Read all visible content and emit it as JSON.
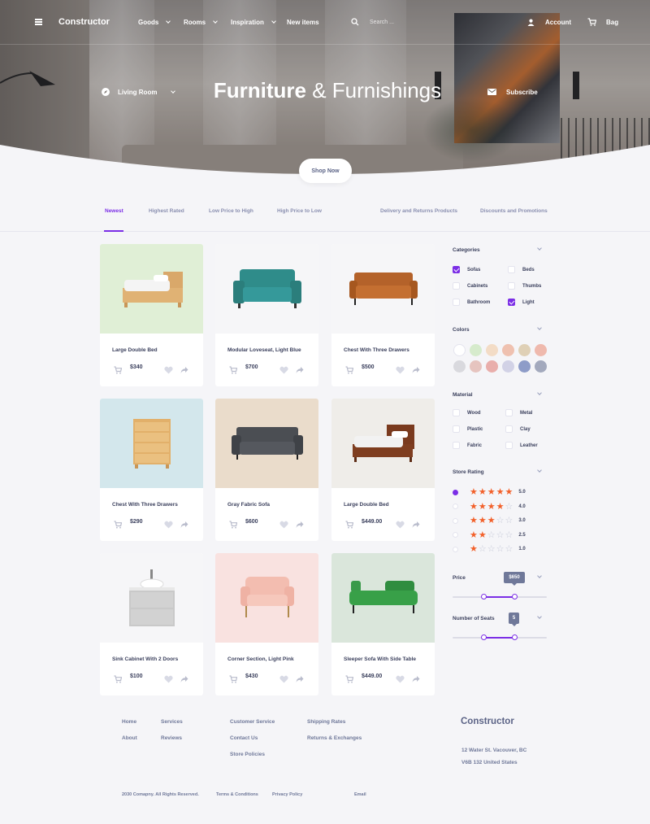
{
  "header": {
    "brand": "Constructor",
    "nav": [
      {
        "label": "Goods"
      },
      {
        "label": "Rooms"
      },
      {
        "label": "Inspiration"
      },
      {
        "label": "New items"
      }
    ],
    "search_placeholder": "Search ...",
    "account_label": "Account",
    "bag_label": "Bag"
  },
  "hero": {
    "room_select": "Living Room",
    "title_bold": "Furniture",
    "title_rest": "& Furnishings",
    "subscribe_label": "Subscribe",
    "shop_button": "Shop Now"
  },
  "tabs": [
    {
      "label": "Newest",
      "active": true
    },
    {
      "label": "Highest Rated"
    },
    {
      "label": "Low Price to High"
    },
    {
      "label": "High Price to Low"
    },
    {
      "label": "Delivery and Returns Products"
    },
    {
      "label": "Discounts and Promotions"
    }
  ],
  "products": [
    {
      "name": "Large Double Bed",
      "price": "$340",
      "bg": "#e0efd6",
      "icon": "bed"
    },
    {
      "name": "Modular Loveseat, Light Blue",
      "price": "$700",
      "bg": "#f6f6f8",
      "icon": "teal-loveseat"
    },
    {
      "name": "Chest With Three Drawers",
      "price": "$500",
      "bg": "#f6f6f8",
      "icon": "brown-sofa"
    },
    {
      "name": "Chest With Three Drawers",
      "price": "$290",
      "bg": "#d3e7ec",
      "icon": "wood-chest"
    },
    {
      "name": "Gray Fabric Sofa",
      "price": "$600",
      "bg": "#eadccb",
      "icon": "gray-sofa"
    },
    {
      "name": "Large Double Bed",
      "price": "$449.00",
      "bg": "#efede9",
      "icon": "dark-bed"
    },
    {
      "name": "Sink Cabinet With 2 Doors",
      "price": "$100",
      "bg": "#f6f6f8",
      "icon": "sink-cabinet"
    },
    {
      "name": "Corner Section, Light Pink",
      "price": "$430",
      "bg": "#f9e2e0",
      "icon": "pink-chair"
    },
    {
      "name": "Sleeper Sofa With Side Table",
      "price": "$449.00",
      "bg": "#dae6db",
      "icon": "green-sofa"
    }
  ],
  "filters": {
    "categories": {
      "title": "Categories",
      "items": [
        {
          "label": "Sofas",
          "checked": true
        },
        {
          "label": "Beds",
          "checked": false
        },
        {
          "label": "Cabinets",
          "checked": false
        },
        {
          "label": "Thumbs",
          "checked": false
        },
        {
          "label": "Bathroom",
          "checked": false
        },
        {
          "label": "Light",
          "checked": true
        }
      ]
    },
    "colors": {
      "title": "Colors",
      "swatches": [
        "#ffffff",
        "#d6ebcc",
        "#f3dcc6",
        "#efc1b0",
        "#dfd0b6",
        "#efb9ad",
        "#d9d9de",
        "#e6c4bf",
        "#e9aeab",
        "#d2d2e6",
        "#8e9cc8",
        "#a3a9bd"
      ]
    },
    "material": {
      "title": "Material",
      "items": [
        {
          "label": "Wood"
        },
        {
          "label": "Metal"
        },
        {
          "label": "Plastic"
        },
        {
          "label": "Clay"
        },
        {
          "label": "Fabric"
        },
        {
          "label": "Leather"
        }
      ]
    },
    "rating": {
      "title": "Store Rating",
      "rows": [
        {
          "stars": 5,
          "value": "5.0",
          "selected": true
        },
        {
          "stars": 4,
          "value": "4.0",
          "selected": false
        },
        {
          "stars": 3,
          "value": "3.0",
          "selected": false
        },
        {
          "stars": 2,
          "value": "2.5",
          "selected": false
        },
        {
          "stars": 1,
          "value": "1.0",
          "selected": false
        }
      ]
    },
    "price": {
      "title": "Price",
      "tooltip": "$650",
      "range_low": 0.33,
      "range_high": 0.66
    },
    "seats": {
      "title": "Number of Seats",
      "tooltip": "5",
      "range_low": 0.33,
      "range_high": 0.66
    }
  },
  "footer": {
    "col1": [
      "Home",
      "About"
    ],
    "col2": [
      "Services",
      "Reviews"
    ],
    "col3": [
      "Customer Service",
      "Contact Us",
      "Store Policies"
    ],
    "col4": [
      "Shipping Rates",
      "Returns & Exchanges"
    ],
    "brand": "Constructor",
    "address1": "12 Water St. Vacouver, BC",
    "address2": "V6B 132 United States",
    "copyright": "2030 Comapny. All Rights Reserved.",
    "terms": "Terms & Conditions",
    "privacy": "Privacy Policy",
    "email": "Email"
  },
  "colors": {
    "accent": "#7b2ee6",
    "star": "#f2602a",
    "star_empty": "#c7cad8"
  }
}
